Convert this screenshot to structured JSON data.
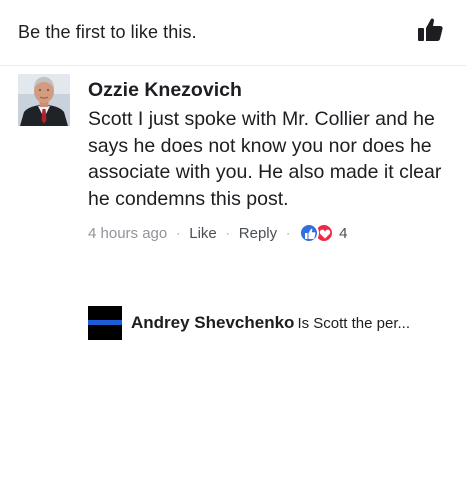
{
  "like_bar": {
    "summary": "Be the first to like this.",
    "like_icon": "thumbs-up-icon"
  },
  "comment": {
    "author": "Ozzie Knezovich",
    "text": "Scott I just spoke with Mr. Collier and he says he does not know you nor does he associate with you. He also made it clear he condemns this post.",
    "timestamp": "4 hours ago",
    "like_label": "Like",
    "reply_label": "Reply",
    "separator": "·",
    "reaction_icons": [
      "like-reaction-icon",
      "love-reaction-icon"
    ],
    "reaction_count": "4"
  },
  "reply": {
    "author": "Andrey Shevchenko",
    "snippet": "Is Scott the per..."
  },
  "colors": {
    "like_blue": "#2f6fde",
    "love_red": "#f0284a",
    "thin_blue_line": "#1e5bd8",
    "muted_text": "#90949c"
  }
}
